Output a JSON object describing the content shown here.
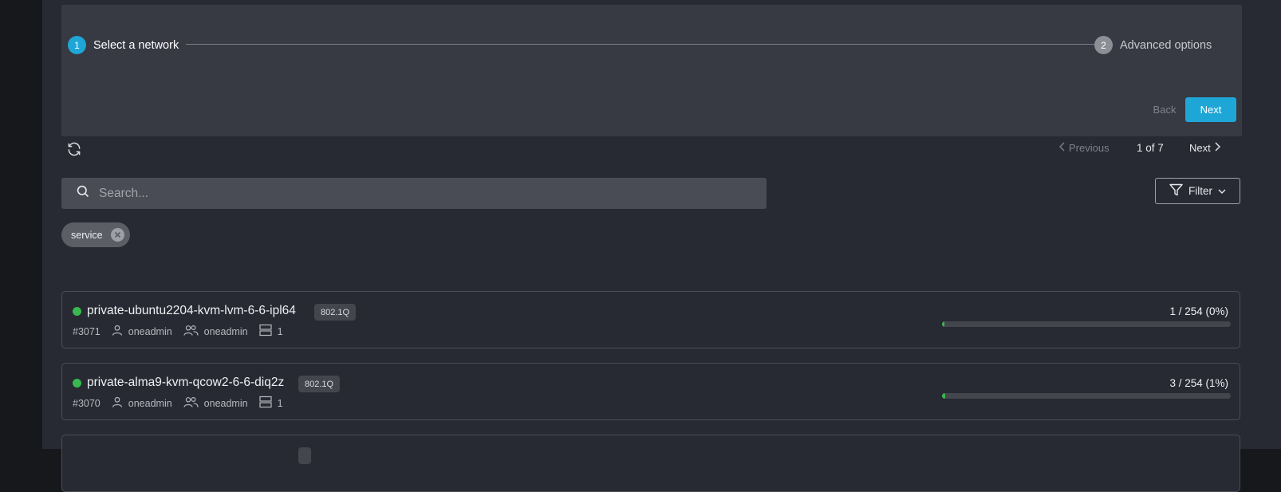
{
  "stepper": {
    "steps": [
      {
        "number": "1",
        "label": "Select a network",
        "active": true
      },
      {
        "number": "2",
        "label": "Advanced options",
        "active": false
      }
    ],
    "back_label": "Back",
    "next_label": "Next"
  },
  "toolbar": {
    "refresh_icon": "refresh-icon",
    "previous_label": "Previous",
    "page_info": "1 of 7",
    "next_label": "Next"
  },
  "search": {
    "placeholder": "Search..."
  },
  "filter": {
    "label": "Filter"
  },
  "chips": [
    {
      "label": "service"
    }
  ],
  "networks": [
    {
      "name": "private-ubuntu2204-kvm-lvm-6-6-ipl64",
      "tag": "802.1Q",
      "id": "#3071",
      "owner": "oneadmin",
      "group": "oneadmin",
      "clusters": "1",
      "usage": "1 / 254 (0%)",
      "usage_fraction": 0.004,
      "status_color": "#38b84e"
    },
    {
      "name": "private-alma9-kvm-qcow2-6-6-diq2z",
      "tag": "802.1Q",
      "id": "#3070",
      "owner": "oneadmin",
      "group": "oneadmin",
      "clusters": "1",
      "usage": "3 / 254 (1%)",
      "usage_fraction": 0.012,
      "status_color": "#38b84e"
    },
    {
      "name": "",
      "tag": "",
      "id": "",
      "owner": "",
      "group": "",
      "clusters": "",
      "usage": "",
      "usage_fraction": 0,
      "status_color": "#38b84e"
    }
  ],
  "colors": {
    "accent": "#1ea7d6",
    "status_ok": "#38b84e",
    "background": "#272a33"
  }
}
